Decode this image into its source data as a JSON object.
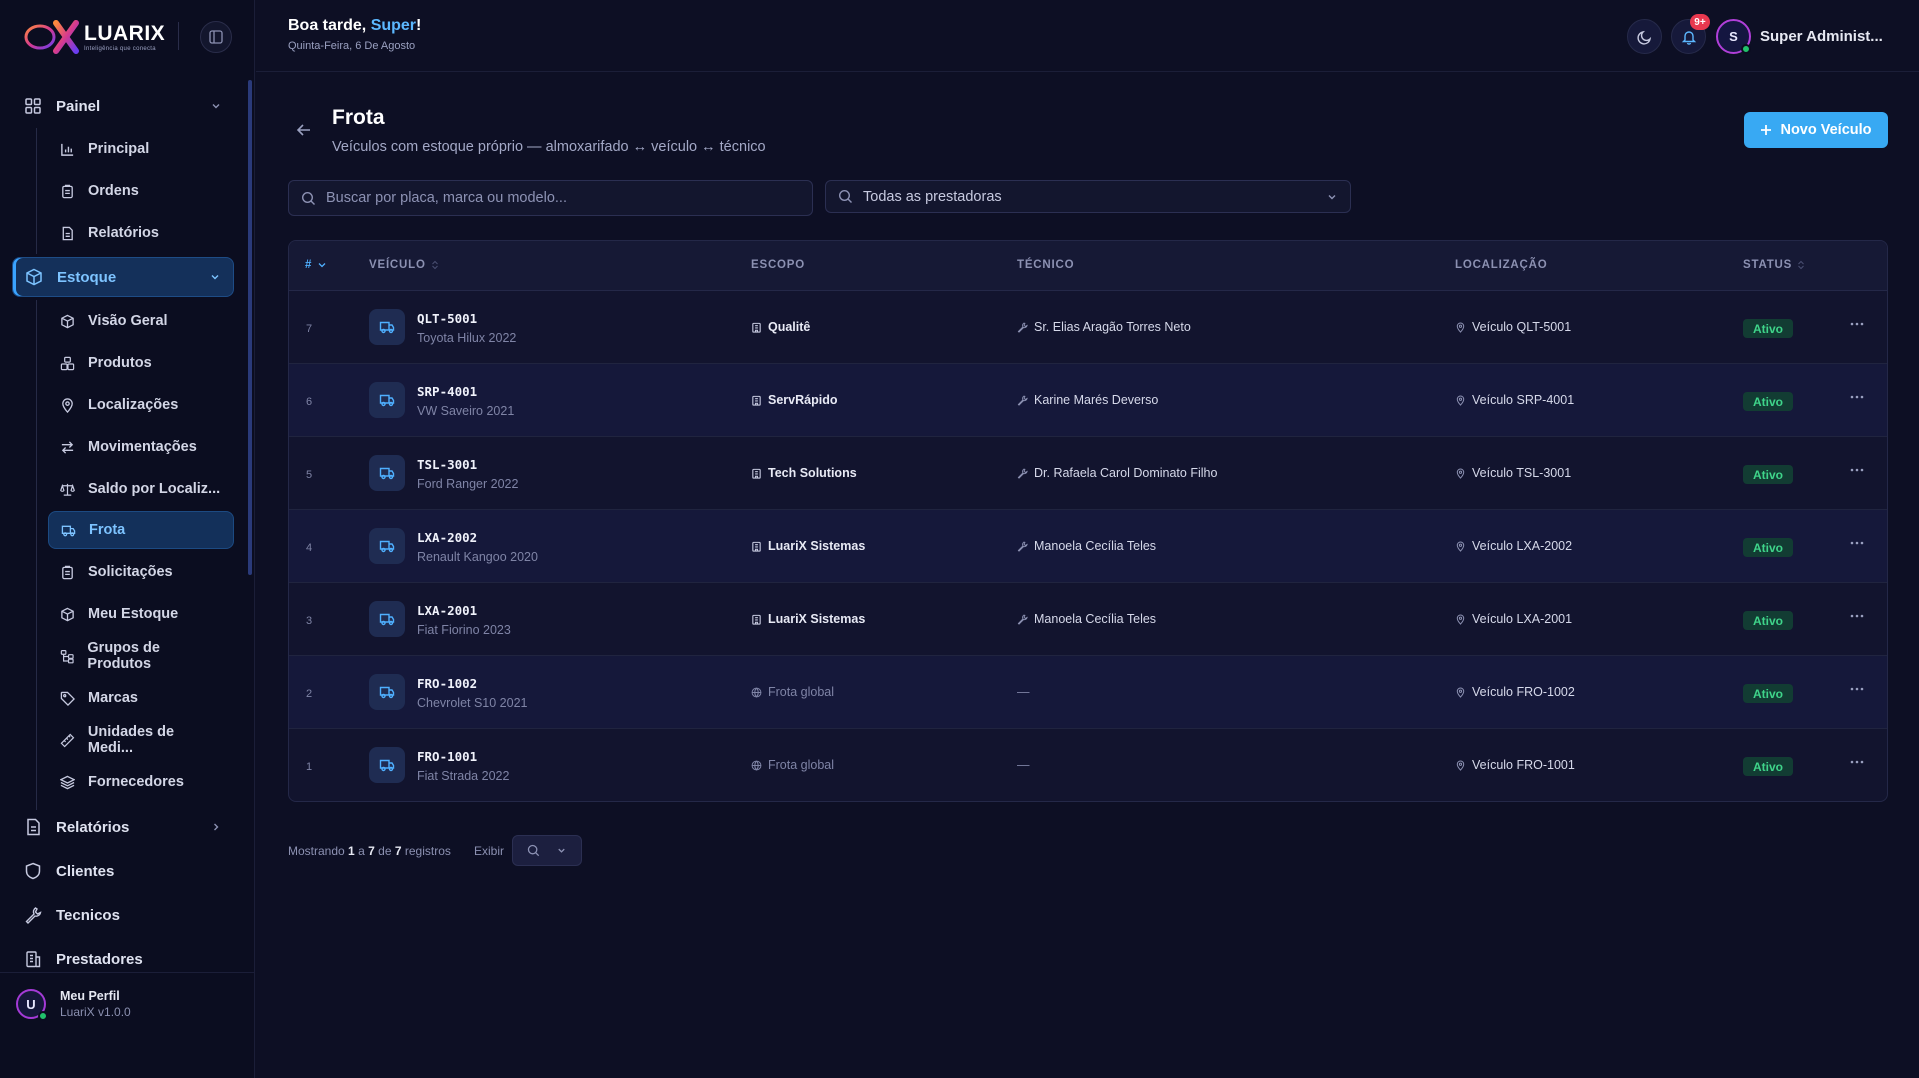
{
  "brand": {
    "name": "LUARIX",
    "tagline": "Inteligência que conecta"
  },
  "header": {
    "greeting_prefix": "Boa tarde, ",
    "greeting_name": "Super",
    "greeting_suffix": "!",
    "date": "Quinta-Feira, 6 De Agosto",
    "notifications_badge": "9+",
    "user_initial": "S",
    "user_name": "Super Administ..."
  },
  "sidebar": {
    "painel": {
      "label": "Painel",
      "items": [
        {
          "label": "Principal",
          "icon": "bar-chart-icon"
        },
        {
          "label": "Ordens",
          "icon": "clipboard-icon"
        },
        {
          "label": "Relatórios",
          "icon": "document-icon"
        }
      ]
    },
    "estoque": {
      "label": "Estoque",
      "items": [
        {
          "label": "Visão Geral",
          "icon": "cube-icon"
        },
        {
          "label": "Produtos",
          "icon": "boxes-icon"
        },
        {
          "label": "Localizações",
          "icon": "map-pin-icon"
        },
        {
          "label": "Movimentações",
          "icon": "swap-icon"
        },
        {
          "label": "Saldo por Localiz...",
          "icon": "scale-icon"
        },
        {
          "label": "Frota",
          "icon": "truck-icon"
        },
        {
          "label": "Solicitações",
          "icon": "clipboard-icon"
        },
        {
          "label": "Meu Estoque",
          "icon": "cube-icon"
        },
        {
          "label": "Grupos de Produtos",
          "icon": "hierarchy-icon"
        },
        {
          "label": "Marcas",
          "icon": "tag-icon"
        },
        {
          "label": "Unidades de Medi...",
          "icon": "ruler-icon"
        },
        {
          "label": "Fornecedores",
          "icon": "layers-icon"
        }
      ]
    },
    "relatorios": {
      "label": "Relatórios"
    },
    "clientes": {
      "label": "Clientes"
    },
    "tecnicos": {
      "label": "Tecnicos"
    },
    "prestadores": {
      "label": "Prestadores"
    },
    "footer": {
      "initial": "U",
      "name": "Meu Perfil",
      "version": "LuariX v1.0.0"
    }
  },
  "page": {
    "title": "Frota",
    "subtitle": "Veículos com estoque próprio — almoxarifado ↔ veículo ↔ técnico",
    "new_button": "Novo Veículo",
    "search_placeholder": "Buscar por placa, marca ou modelo...",
    "provider_filter": "Todas as prestadoras"
  },
  "table": {
    "columns": {
      "num": "#",
      "vehicle": "VEÍCULO",
      "scope": "ESCOPO",
      "tech": "TÉCNICO",
      "location": "LOCALIZAÇÃO",
      "status": "STATUS"
    },
    "rows": [
      {
        "num": "7",
        "plate": "QLT-5001",
        "model": "Toyota Hilux 2022",
        "scope": "Qualitê",
        "scope_global": false,
        "tech": "Sr. Elias Aragão Torres Neto",
        "location": "Veículo QLT-5001",
        "status": "Ativo"
      },
      {
        "num": "6",
        "plate": "SRP-4001",
        "model": "VW Saveiro 2021",
        "scope": "ServRápido",
        "scope_global": false,
        "tech": "Karine Marés Deverso",
        "location": "Veículo SRP-4001",
        "status": "Ativo"
      },
      {
        "num": "5",
        "plate": "TSL-3001",
        "model": "Ford Ranger 2022",
        "scope": "Tech Solutions",
        "scope_global": false,
        "tech": "Dr. Rafaela Carol Dominato Filho",
        "location": "Veículo TSL-3001",
        "status": "Ativo"
      },
      {
        "num": "4",
        "plate": "LXA-2002",
        "model": "Renault Kangoo 2020",
        "scope": "LuariX Sistemas",
        "scope_global": false,
        "tech": "Manoela Cecília Teles",
        "location": "Veículo LXA-2002",
        "status": "Ativo"
      },
      {
        "num": "3",
        "plate": "LXA-2001",
        "model": "Fiat Fiorino 2023",
        "scope": "LuariX Sistemas",
        "scope_global": false,
        "tech": "Manoela Cecília Teles",
        "location": "Veículo LXA-2001",
        "status": "Ativo"
      },
      {
        "num": "2",
        "plate": "FRO-1002",
        "model": "Chevrolet S10 2021",
        "scope": "Frota global",
        "scope_global": true,
        "tech": "—",
        "location": "Veículo FRO-1002",
        "status": "Ativo"
      },
      {
        "num": "1",
        "plate": "FRO-1001",
        "model": "Fiat Strada 2022",
        "scope": "Frota global",
        "scope_global": true,
        "tech": "—",
        "location": "Veículo FRO-1001",
        "status": "Ativo"
      }
    ]
  },
  "pagination": {
    "prefix": "Mostrando",
    "from": "1",
    "sep1": "a",
    "to": "7",
    "sep2": "de",
    "total": "7",
    "suffix": "registros",
    "show_label": "Exibir"
  },
  "colors": {
    "accent": "#38a9f3",
    "active_nav": "#7dc3ff",
    "status_ok": "#3fd48a",
    "badge": "#e8384f"
  }
}
